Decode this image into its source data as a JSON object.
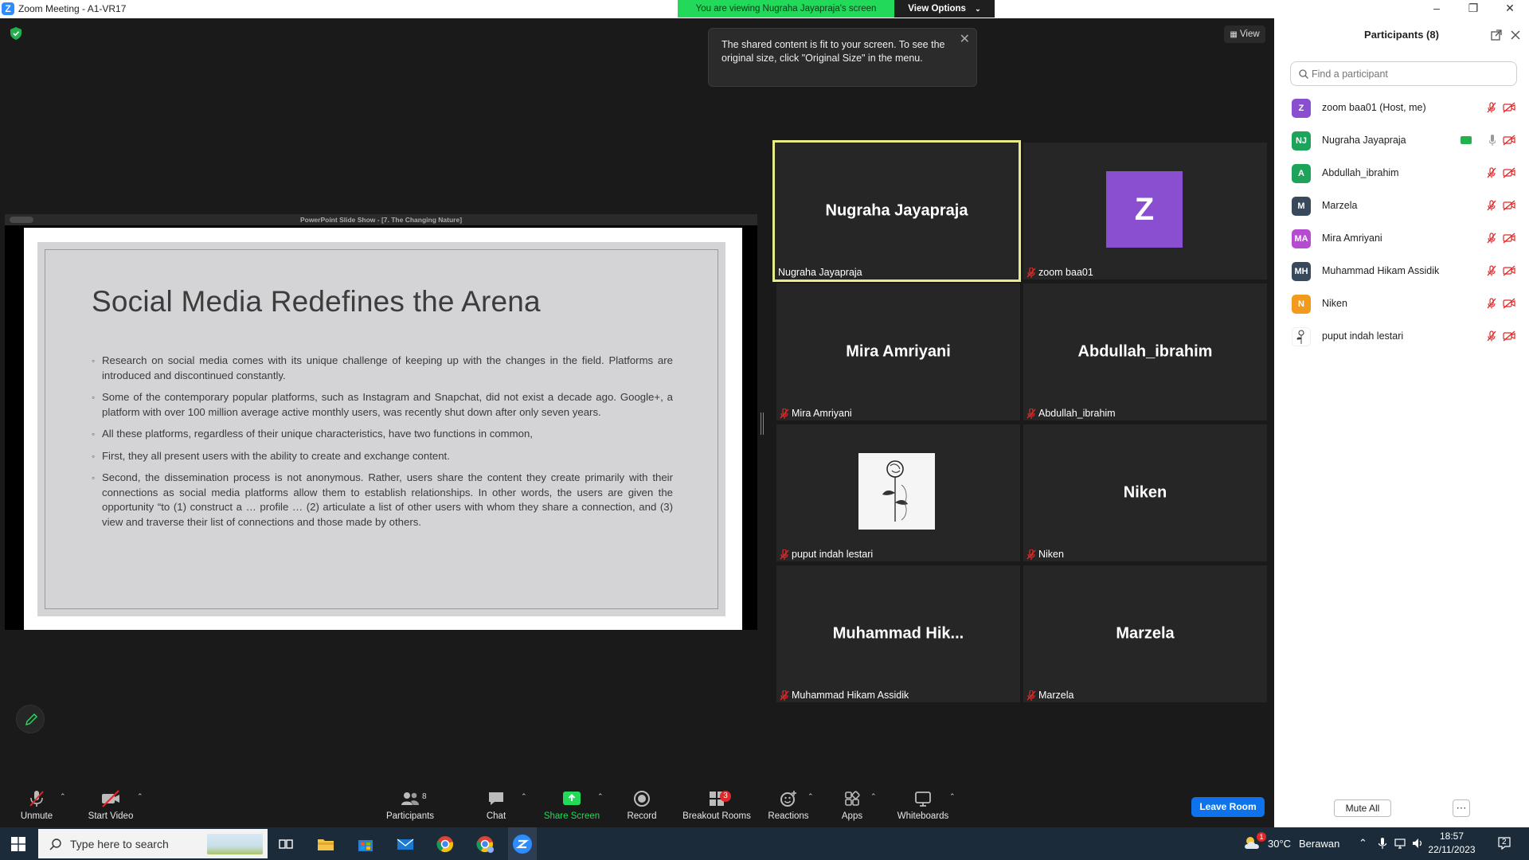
{
  "window": {
    "title": "Zoom Meeting - A1-VR17",
    "logo_letter": "Z"
  },
  "banner": {
    "viewing_text": "You are viewing Nugraha Jayapraja's screen",
    "options_label": "View Options"
  },
  "view_button": {
    "label": "View"
  },
  "tooltip": {
    "text": "The shared content is fit to your screen. To see the original size, click \"Original Size\" in the menu."
  },
  "share": {
    "window_title": "PowerPoint Slide Show - [7. The Changing Nature]",
    "slide_title": "Social Media Redefines the Arena",
    "bullets": [
      "Research on social media comes with its unique challenge of keeping up with the changes in the field. Platforms are introduced and discontinued constantly.",
      "Some of the contemporary popular platforms, such as Instagram and Snapchat, did not exist a decade ago. Google+, a platform with over 100 million average active monthly users, was recently shut down after only seven years.",
      "All these platforms, regardless of their unique characteristics, have two functions in common,",
      "First, they all present users with the ability to create and exchange content.",
      "Second, the dissemination process is not anonymous. Rather, users share the content they create primarily with their connections as social media platforms allow them to establish relationships. In other words, the users are given the opportunity “to (1) construct a … profile … (2) articulate a list of other users with whom they share a connection, and (3) view and traverse their list of connections and those made by others."
    ]
  },
  "tiles": [
    {
      "big": "Nugraha Jayapraja",
      "label": "Nugraha Jayapraja",
      "muted": false
    },
    {
      "big": "",
      "avatar_letter": "Z",
      "label": "zoom baa01",
      "muted": true
    },
    {
      "big": "Mira Amriyani",
      "label": "Mira Amriyani",
      "muted": true
    },
    {
      "big": "Abdullah_ibrahim",
      "label": "Abdullah_ibrahim",
      "muted": true
    },
    {
      "big": "",
      "label": "puput indah lestari",
      "muted": true
    },
    {
      "big": "Niken",
      "label": "Niken",
      "muted": true
    },
    {
      "big": "Muhammad  Hik...",
      "label": "Muhammad Hikam Assidik",
      "muted": true
    },
    {
      "big": "Marzela",
      "label": "Marzela",
      "muted": true
    }
  ],
  "toolbar": {
    "unmute": "Unmute",
    "start_video": "Start Video",
    "participants": "Participants",
    "participants_count": "8",
    "chat": "Chat",
    "share_screen": "Share Screen",
    "record": "Record",
    "breakout_rooms": "Breakout Rooms",
    "breakout_badge": "3",
    "reactions": "Reactions",
    "apps": "Apps",
    "whiteboards": "Whiteboards",
    "leave_room": "Leave Room"
  },
  "panel": {
    "title": "Participants (8)",
    "search_placeholder": "Find a participant",
    "participants": [
      {
        "initials": "Z",
        "name": "zoom baa01 (Host, me)",
        "color": "#8a4fd0"
      },
      {
        "initials": "NJ",
        "name": "Nugraha Jayapraja",
        "color": "#1ea35b"
      },
      {
        "initials": "A",
        "name": "Abdullah_ibrahim",
        "color": "#1ea35b"
      },
      {
        "initials": "M",
        "name": "Marzela",
        "color": "#39495c"
      },
      {
        "initials": "MA",
        "name": "Mira Amriyani",
        "color": "#b54bd1"
      },
      {
        "initials": "MH",
        "name": "Muhammad Hikam Assidik",
        "color": "#39495c"
      },
      {
        "initials": "N",
        "name": "Niken",
        "color": "#f29a1e"
      },
      {
        "initials": "",
        "name": "puput indah lestari",
        "color": "#ffffff"
      }
    ],
    "mute_all": "Mute All",
    "more": "⋯"
  },
  "taskbar": {
    "search_placeholder": "Type here to search",
    "temperature": "30°C",
    "weather": "Berawan",
    "time": "18:57",
    "date": "22/11/2023",
    "notification_count": "2",
    "weather_badge": "1"
  },
  "colors": {
    "zoom_blue": "#0e72ed",
    "share_green": "#23d959",
    "mute_red": "#e02828",
    "active_speaker": "#e8ec88"
  }
}
